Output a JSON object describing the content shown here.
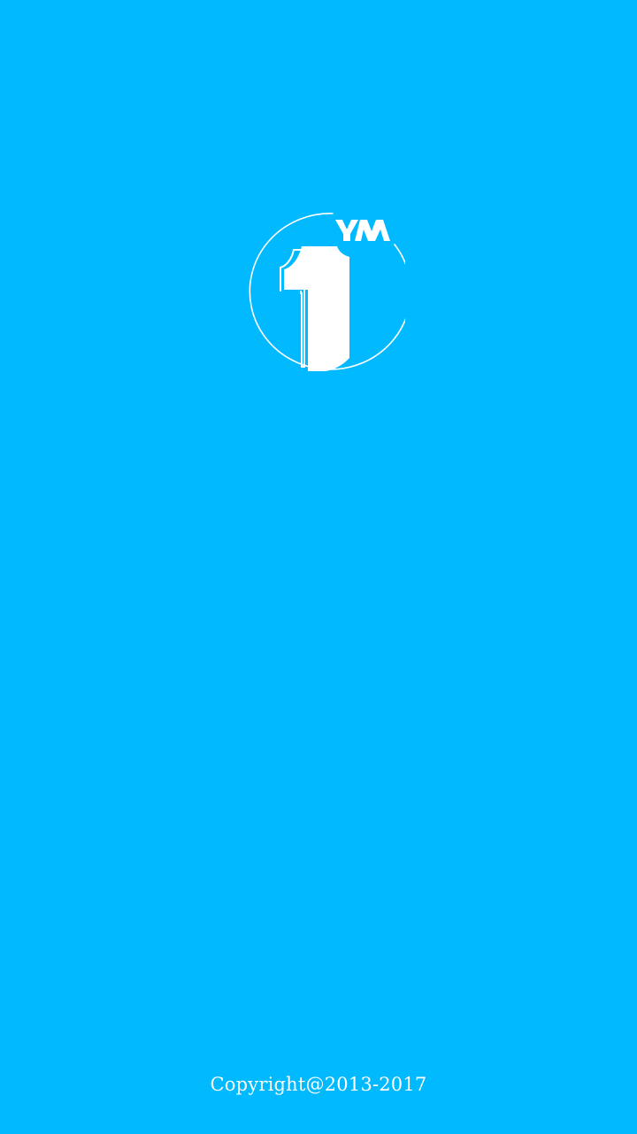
{
  "app": {
    "screen": "splash",
    "background_color": "#00B9FF",
    "logo": {
      "icon": "ym-number-one-logo-icon",
      "lettering": "YM",
      "color": "#FFFFFF"
    }
  },
  "footer": {
    "copyright": "Copyright@2013-2017"
  }
}
